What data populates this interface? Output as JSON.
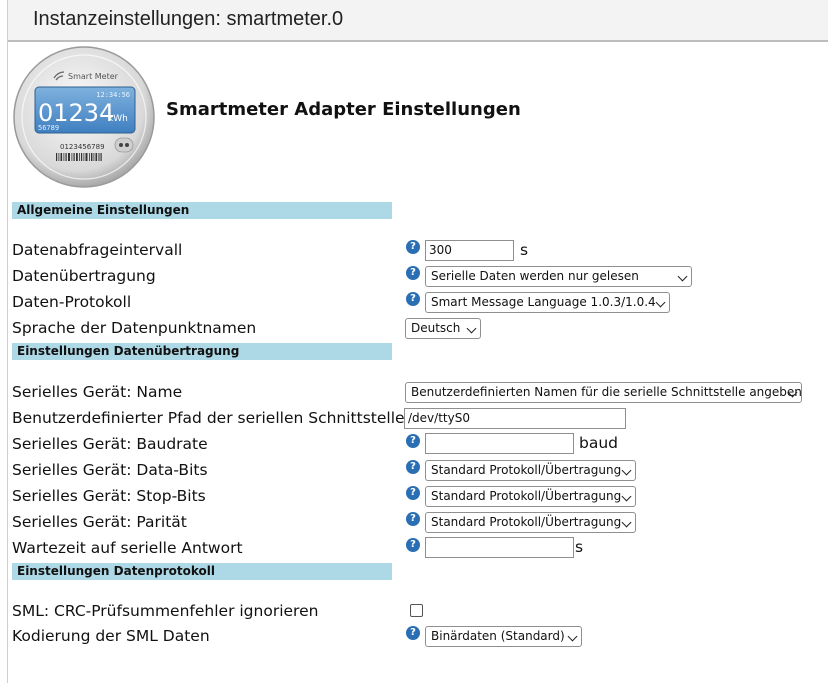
{
  "window": {
    "title": "Instanzeinstellungen: smartmeter.0"
  },
  "header": {
    "heading": "Smartmeter Adapter Einstellungen",
    "meter_brand": "Smart Meter",
    "meter_time": "12:34:56",
    "meter_reading": "01234",
    "meter_unit": "kWh",
    "meter_sub": "56789",
    "meter_serial": "0123456789"
  },
  "sections": {
    "general": "Allgemeine Einstellungen",
    "transfer": "Einstellungen Datenübertragung",
    "protocol": "Einstellungen Datenprotokoll"
  },
  "fields": {
    "interval": {
      "label": "Datenabfrageintervall",
      "value": "300",
      "unit": "s"
    },
    "transmission": {
      "label": "Datenübertragung",
      "value": "Serielle Daten werden nur gelesen"
    },
    "protocol": {
      "label": "Daten-Protokoll",
      "value": "Smart Message Language 1.0.3/1.0.4"
    },
    "language": {
      "label": "Sprache der Datenpunktnamen",
      "value": "Deutsch"
    },
    "serial_name": {
      "label": "Serielles Gerät: Name",
      "value": "Benutzerdefinierten Namen für die serielle Schnittstelle angeben"
    },
    "serial_path": {
      "label": "Benutzerdefinierter Pfad der seriellen Schnittstelle",
      "value": "/dev/ttyS0"
    },
    "baudrate": {
      "label": "Serielles Gerät: Baudrate",
      "value": "",
      "unit": "baud"
    },
    "databits": {
      "label": "Serielles Gerät: Data-Bits",
      "value": "Standard Protokoll/Übertragung"
    },
    "stopbits": {
      "label": "Serielles Gerät: Stop-Bits",
      "value": "Standard Protokoll/Übertragung"
    },
    "parity": {
      "label": "Serielles Gerät: Parität",
      "value": "Standard Protokoll/Übertragung"
    },
    "wait": {
      "label": "Wartezeit auf serielle Antwort",
      "value": "",
      "unit": "s"
    },
    "crc": {
      "label": "SML: CRC-Prüfsummenfehler ignorieren",
      "checked": false
    },
    "encoding": {
      "label": "Kodierung der SML Daten",
      "value": "Binärdaten (Standard)"
    }
  },
  "help_icon_glyph": "?"
}
